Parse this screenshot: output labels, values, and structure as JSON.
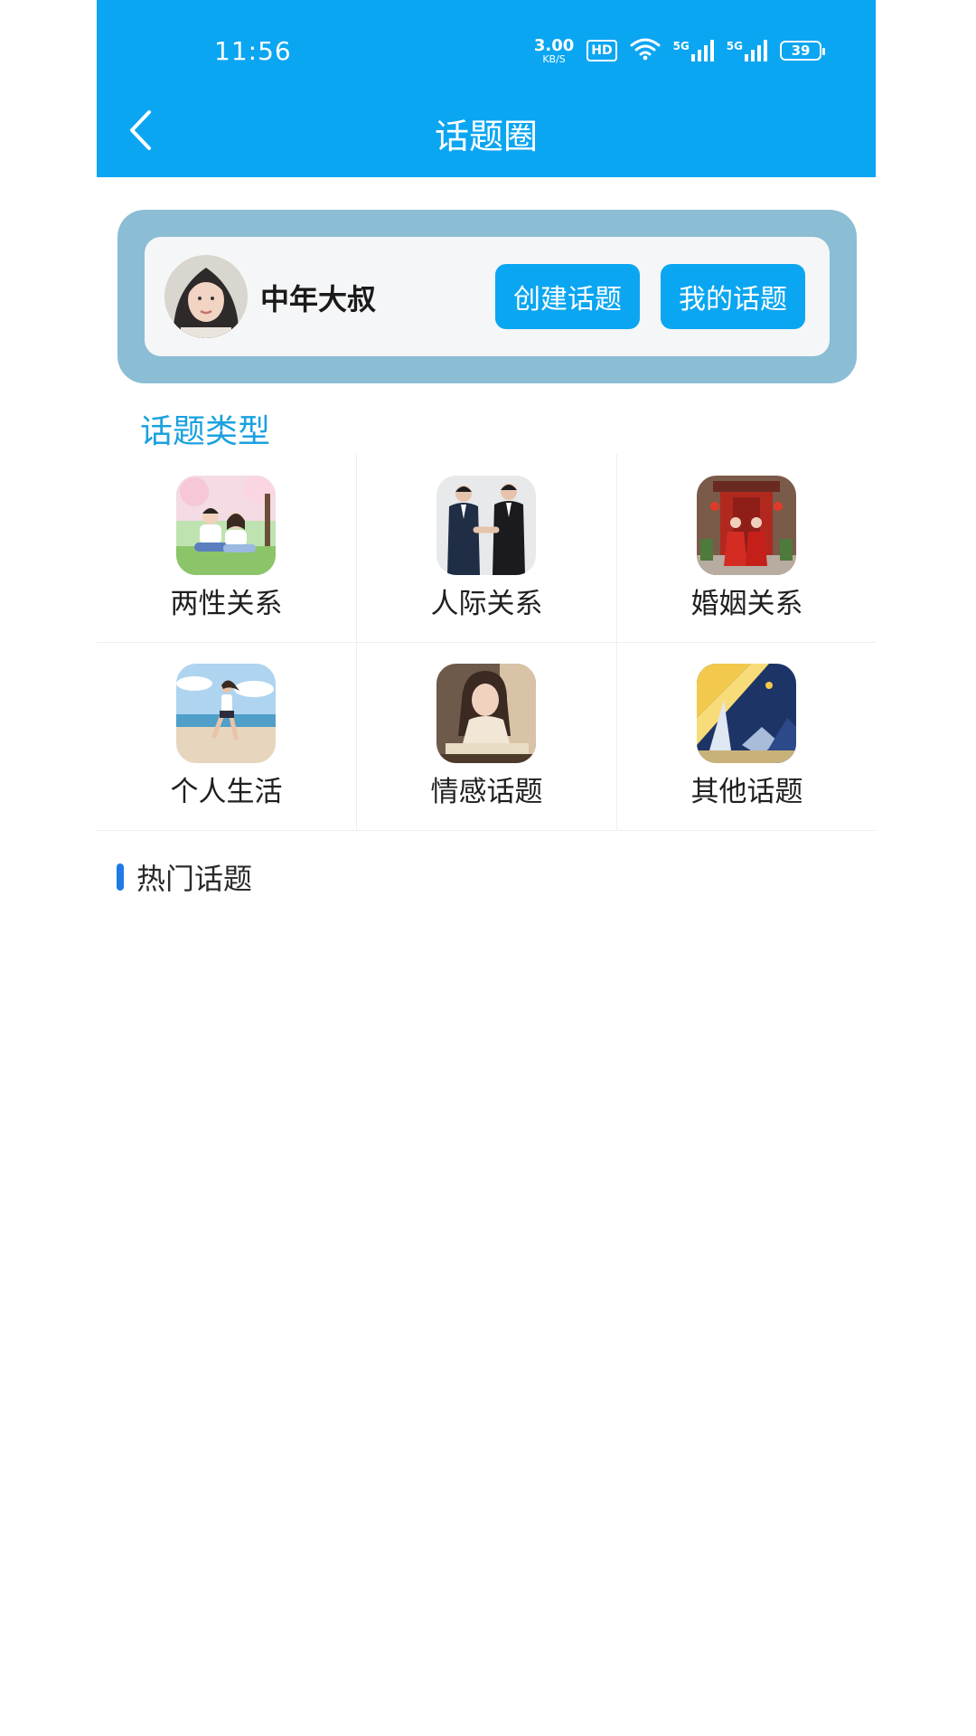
{
  "status_bar": {
    "time": "11:56",
    "net_speed_value": "3.00",
    "net_speed_unit": "KB/S",
    "hd_label": "HD",
    "sim1_label": "5G",
    "sim2_label": "5G",
    "battery": "39"
  },
  "header": {
    "title": "话题圈",
    "back_icon": "chevron-left-icon"
  },
  "profile": {
    "username": "中年大叔",
    "create_label": "创建话题",
    "mine_label": "我的话题"
  },
  "topic_types": {
    "title": "话题类型",
    "items": [
      {
        "label": "两性关系"
      },
      {
        "label": "人际关系"
      },
      {
        "label": "婚姻关系"
      },
      {
        "label": "个人生活"
      },
      {
        "label": "情感话题"
      },
      {
        "label": "其他话题"
      }
    ]
  },
  "hot_topics": {
    "title": "热门话题"
  },
  "colors": {
    "primary": "#0ba6f2",
    "card_frame": "#8bbdd4",
    "section_title": "#1aa1df",
    "hot_bar": "#1f7ae8"
  }
}
